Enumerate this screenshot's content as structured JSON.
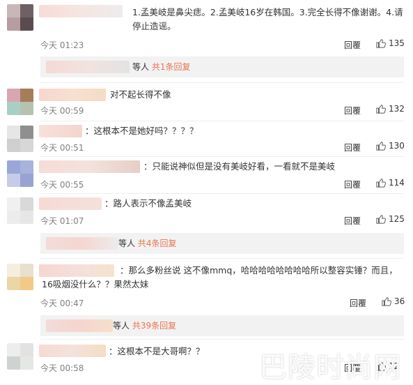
{
  "comments": [
    {
      "text": "1.孟美岐是鼻尖痣。2.孟美岐16岁在韩国。3.完全长得不像谢谢。4.请停止造谣。",
      "time": "今天 01:23",
      "reply": "回覆",
      "likes": "135",
      "sub_replies": {
        "prefix": "等人",
        "count": "共1条回复"
      }
    },
    {
      "text": "对不起长得不像",
      "time": "今天 00:59",
      "reply": "回覆",
      "likes": "132"
    },
    {
      "text": "：这根本不是她好吗？？？？",
      "time": "今天 00:51",
      "reply": "回覆",
      "likes": "130"
    },
    {
      "text": "：只能说神似但是没有美岐好看，一看就不是美岐",
      "time": "今天 00:55",
      "reply": "回覆",
      "likes": "114"
    },
    {
      "text": "：路人表示不像孟美岐",
      "time": "今天 01:07",
      "reply": "回覆",
      "likes": "125",
      "sub_replies": {
        "prefix": "等人",
        "count": "共4条回复"
      }
    },
    {
      "text": "：那么多粉丝说 这不像mmq，哈哈哈哈哈哈哈哈所以整容实锤？而且，16吸烟没什么？？果然太妹",
      "time": "今天 00:47",
      "reply": "回覆",
      "likes": "36",
      "sub_replies": {
        "prefix": "等人",
        "count": "共39条回复"
      }
    },
    {
      "text": "：这根本不是大哥啊？？",
      "time": "今天 00:58",
      "reply": "回覆",
      "likes": "12"
    }
  ],
  "watermark": "巴陵时尚网",
  "colors": {
    "accent": "#eb7350",
    "muted": "#808080",
    "subbar_bg": "#f2f2f2"
  },
  "icons": {
    "like": "thumbs-up-icon"
  }
}
